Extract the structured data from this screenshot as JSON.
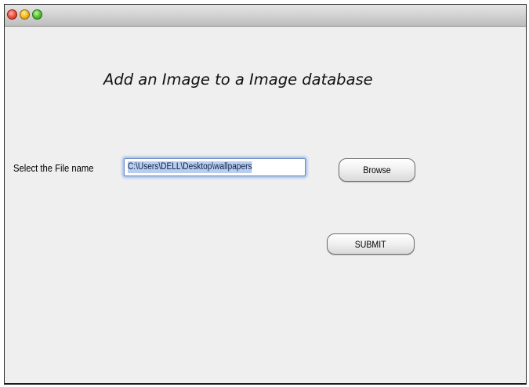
{
  "window": {
    "controls": [
      "close-icon",
      "minimize-icon",
      "zoom-icon"
    ],
    "colors": {
      "close": "#e8483a",
      "minimize": "#f4bf2d",
      "zoom": "#4fbb33",
      "background": "#efefef"
    }
  },
  "form": {
    "heading": "Add an Image to a Image database",
    "file_label": "Select the File name",
    "file_path": "C:\\Users\\DELL\\Desktop\\wallpapers",
    "browse_label": "Browse",
    "submit_label": "SUBMIT"
  }
}
